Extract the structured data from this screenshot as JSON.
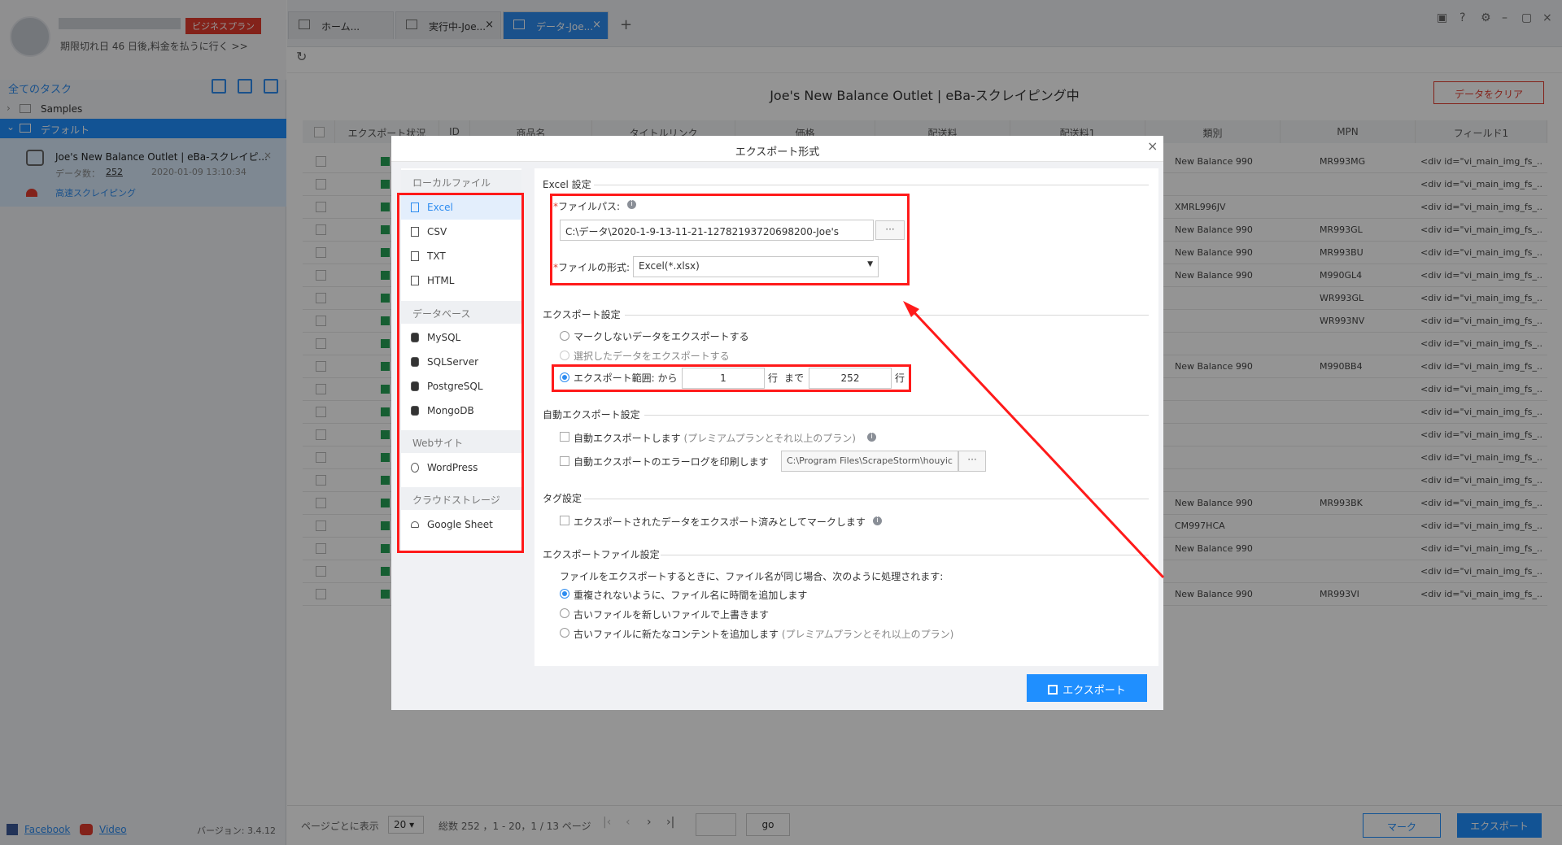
{
  "sidebar": {
    "plan_badge": "ビジネスプラン",
    "expire_text": "期限切れ日 46 日後,料金を払うに行く >>",
    "tasks_title": "全てのタスク",
    "tree": [
      {
        "label": "Samples"
      },
      {
        "label": "デフォルト"
      }
    ],
    "task": {
      "name": "Joe's New Balance Outlet | eBa-スクレイピ...",
      "count_label": "データ数：",
      "count": "252",
      "date": "2020-01-09 13:10:34",
      "mode": "高速スクレイピング"
    },
    "footer": {
      "facebook": "Facebook",
      "video": "Video",
      "version": "バージョン: 3.4.12"
    }
  },
  "tabs": [
    {
      "label": "ホーム..."
    },
    {
      "label": "実行中-Joe..."
    },
    {
      "label": "データ-Joe..."
    }
  ],
  "page": {
    "title": "Joe's New Balance Outlet | eBa-スクレイピング中",
    "clear_button": "データをクリア"
  },
  "table": {
    "headers": [
      "エクスポート状況",
      "ID",
      "商品名",
      "タイトルリンク",
      "価格",
      "配送料",
      "配送料1",
      "類別",
      "MPN",
      "フィールド1"
    ],
    "rows": [
      {
        "cat": "New Balance 990",
        "mpn": "MR993MG",
        "f1": "<div id=\"vi_main_img_fs_..."
      },
      {
        "cat": "",
        "mpn": "",
        "f1": "<div id=\"vi_main_img_fs_..."
      },
      {
        "cat": "XMRL996JV",
        "mpn": "",
        "f1": "<div id=\"vi_main_img_fs_..."
      },
      {
        "cat": "New Balance 990",
        "mpn": "MR993GL",
        "f1": "<div id=\"vi_main_img_fs_..."
      },
      {
        "cat": "New Balance 990",
        "mpn": "MR993BU",
        "f1": "<div id=\"vi_main_img_fs_..."
      },
      {
        "cat": "New Balance 990",
        "mpn": "M990GL4",
        "f1": "<div id=\"vi_main_img_fs_..."
      },
      {
        "cat": "",
        "mpn": "WR993GL",
        "f1": "<div id=\"vi_main_img_fs_..."
      },
      {
        "cat": "",
        "mpn": "WR993NV",
        "f1": "<div id=\"vi_main_img_fs_..."
      },
      {
        "cat": "",
        "mpn": "",
        "f1": "<div id=\"vi_main_img_fs_..."
      },
      {
        "cat": "New Balance 990",
        "mpn": "M990BB4",
        "f1": "<div id=\"vi_main_img_fs_..."
      },
      {
        "cat": "",
        "mpn": "",
        "f1": "<div id=\"vi_main_img_fs_..."
      },
      {
        "cat": "",
        "mpn": "",
        "f1": "<div id=\"vi_main_img_fs_..."
      },
      {
        "cat": "",
        "mpn": "",
        "f1": "<div id=\"vi_main_img_fs_..."
      },
      {
        "cat": "",
        "mpn": "",
        "f1": "<div id=\"vi_main_img_fs_..."
      },
      {
        "cat": "",
        "mpn": "",
        "f1": "<div id=\"vi_main_img_fs_..."
      },
      {
        "cat": "New Balance 990",
        "mpn": "MR993BK",
        "f1": "<div id=\"vi_main_img_fs_..."
      },
      {
        "cat": "CM997HCA",
        "mpn": "",
        "f1": "<div id=\"vi_main_img_fs_..."
      },
      {
        "cat": "New Balance 990",
        "mpn": "",
        "f1": "<div id=\"vi_main_img_fs_..."
      },
      {
        "cat": "",
        "mpn": "",
        "f1": "<div id=\"vi_main_img_fs_..."
      },
      {
        "cat": "New Balance 990",
        "mpn": "MR993VI",
        "f1": "<div id=\"vi_main_img_fs_..."
      }
    ]
  },
  "pager": {
    "per_page_label": "ページごとに表示",
    "per_page": "20",
    "summary": "総数 252 ，1 - 20，1 / 13 ページ",
    "go": "go",
    "mark_button": "マーク",
    "export_button": "エクスポート"
  },
  "modal": {
    "title": "エクスポート形式",
    "groups": [
      {
        "label": "ローカルファイル",
        "items": [
          "Excel",
          "CSV",
          "TXT",
          "HTML"
        ]
      },
      {
        "label": "データベース",
        "items": [
          "MySQL",
          "SQLServer",
          "PostgreSQL",
          "MongoDB"
        ]
      },
      {
        "label": "Webサイト",
        "items": [
          "WordPress"
        ]
      },
      {
        "label": "クラウドストレージ",
        "items": [
          "Google Sheet"
        ]
      }
    ],
    "excel": {
      "section": "Excel 設定",
      "path_label": "ファイルパス:",
      "path_value": "C:\\データ\\2020-1-9-13-11-21-12782193720698200-Joe's",
      "dots": "···",
      "format_label": "ファイルの形式:",
      "format_value": "Excel(*.xlsx)"
    },
    "export_settings": {
      "section": "エクスポート設定",
      "opt_unmarked": "マークしないデータをエクスポートする",
      "opt_selected": "選択したデータをエクスポートする",
      "opt_range": "エクスポート範囲: から",
      "from": "1",
      "row1": "行",
      "to_label": "まで",
      "to": "252",
      "row2": "行"
    },
    "auto": {
      "section": "自動エクスポート設定",
      "auto_export": "自動エクスポートします",
      "auto_note": "(プレミアムプランとそれ以上のプラン)",
      "error_log": "自動エクスポートのエラーログを印刷します",
      "log_path": "C:\\Program Files\\ScrapeStorm\\houyic"
    },
    "tag": {
      "section": "タグ設定",
      "mark_exported": "エクスポートされたデータをエクスポート済みとしてマークします"
    },
    "file": {
      "section": "エクスポートファイル設定",
      "desc": "ファイルをエクスポートするときに、ファイル名が同じ場合、次のように処理されます:",
      "opt_time": "重複されないように、ファイル名に時間を追加します",
      "opt_overwrite": "古いファイルを新しいファイルで上書きます",
      "opt_append": "古いファイルに新たなコンテントを追加します",
      "append_note": "(プレミアムプランとそれ以上のプラン)"
    },
    "export_button": "エクスポート"
  }
}
